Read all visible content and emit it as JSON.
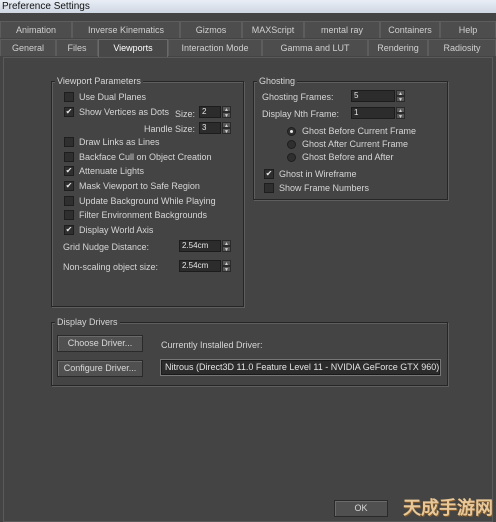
{
  "window": {
    "title": "Preference Settings"
  },
  "tabs_row1": [
    {
      "label": "Animation"
    },
    {
      "label": "Inverse Kinematics"
    },
    {
      "label": "Gizmos"
    },
    {
      "label": "MAXScript"
    },
    {
      "label": "mental ray"
    },
    {
      "label": "Containers"
    },
    {
      "label": "Help"
    }
  ],
  "tabs_row2": [
    {
      "label": "General"
    },
    {
      "label": "Files"
    },
    {
      "label": "Viewports"
    },
    {
      "label": "Interaction Mode"
    },
    {
      "label": "Gamma and LUT"
    },
    {
      "label": "Rendering"
    },
    {
      "label": "Radiosity"
    }
  ],
  "active_tab": "Viewports",
  "viewport": {
    "title": "Viewport Parameters",
    "use_dual_planes": {
      "label": "Use Dual Planes",
      "checked": false
    },
    "show_vertices": {
      "label": "Show Vertices as Dots",
      "checked": true
    },
    "size_label": "Size:",
    "size_value": "2",
    "handle_size_label": "Handle Size:",
    "handle_size_value": "3",
    "options": [
      {
        "label": "Draw Links as Lines",
        "checked": false
      },
      {
        "label": "Backface Cull on Object Creation",
        "checked": false
      },
      {
        "label": "Attenuate Lights",
        "checked": true
      },
      {
        "label": "Mask Viewport to Safe Region",
        "checked": true
      },
      {
        "label": "Update Background While Playing",
        "checked": false
      },
      {
        "label": "Filter Environment Backgrounds",
        "checked": false
      },
      {
        "label": "Display World Axis",
        "checked": true
      }
    ],
    "grid_nudge_label": "Grid Nudge Distance:",
    "grid_nudge_value": "2.54cm",
    "non_scaling_label": "Non-scaling object size:",
    "non_scaling_value": "2.54cm"
  },
  "ghosting": {
    "title": "Ghosting",
    "frames_label": "Ghosting Frames:",
    "frames_value": "5",
    "nth_label": "Display Nth Frame:",
    "nth_value": "1",
    "radios": [
      {
        "label": "Ghost Before Current Frame",
        "selected": true
      },
      {
        "label": "Ghost After Current Frame",
        "selected": false
      },
      {
        "label": "Ghost Before and After",
        "selected": false
      }
    ],
    "ghost_in_wireframe": {
      "label": "Ghost in Wireframe",
      "checked": true
    },
    "show_frame_numbers": {
      "label": "Show Frame Numbers",
      "checked": false
    }
  },
  "display_drivers": {
    "title": "Display Drivers",
    "choose_label": "Choose Driver...",
    "configure_label": "Configure Driver...",
    "installed_label": "Currently Installed Driver:",
    "driver_value": "Nitrous (Direct3D 11.0 Feature Level 11 - NVIDIA GeForce GTX 960)"
  },
  "footer": {
    "ok_label": "OK"
  },
  "watermark": "天成手游网"
}
